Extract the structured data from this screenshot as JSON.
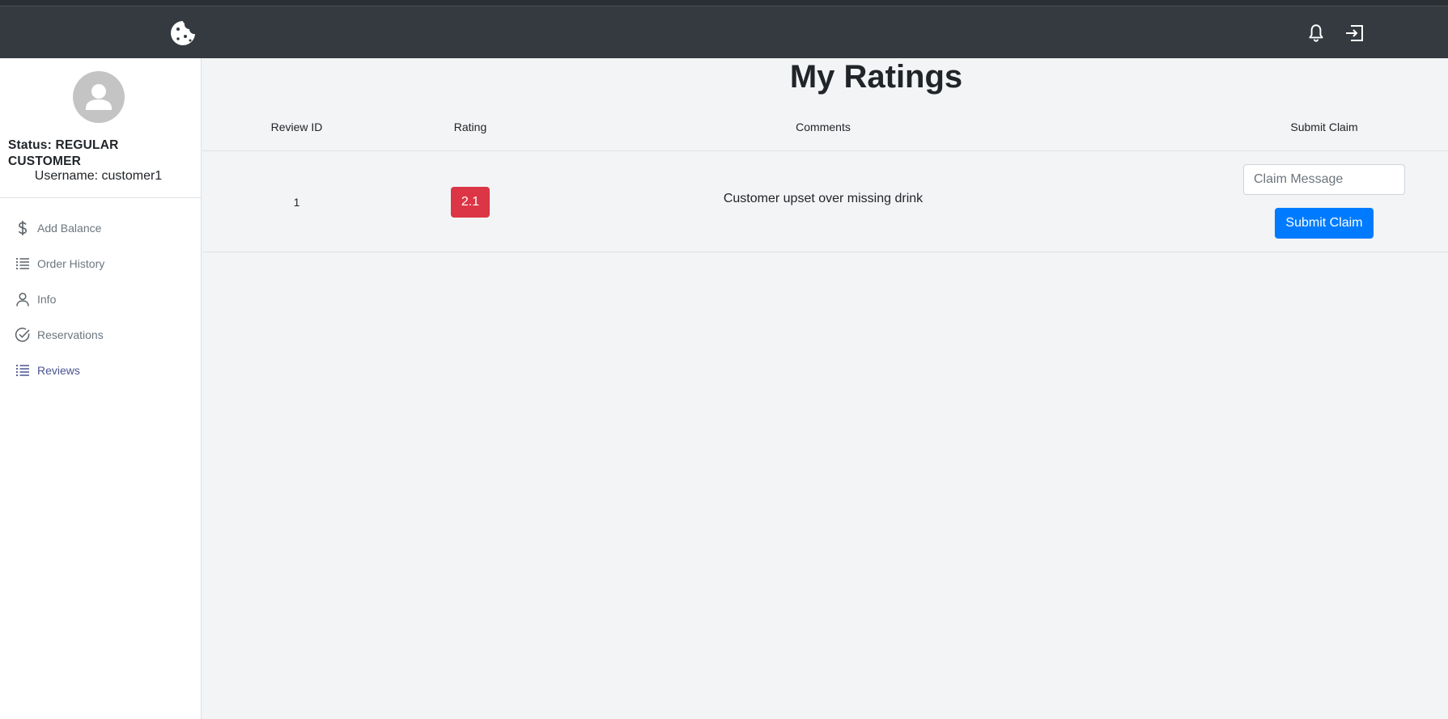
{
  "navbar": {
    "logo_icon": "cookie-icon",
    "bell_icon": "bell-icon",
    "logout_icon": "logout-icon"
  },
  "sidebar": {
    "status": "Status: REGULAR CUSTOMER",
    "username": "Username: customer1",
    "items": [
      {
        "label": "Add Balance",
        "icon": "dollar-icon"
      },
      {
        "label": "Order History",
        "icon": "list-icon"
      },
      {
        "label": "Info",
        "icon": "person-icon"
      },
      {
        "label": "Reservations",
        "icon": "check-circle-icon"
      },
      {
        "label": "Reviews",
        "icon": "list-icon",
        "active": true
      }
    ]
  },
  "main": {
    "title": "My Ratings",
    "columns": [
      "Review ID",
      "Rating",
      "Comments",
      "Submit Claim"
    ],
    "rows": [
      {
        "review_id": "1",
        "rating": "2.1",
        "comment": "Customer upset over missing drink",
        "claim_placeholder": "Claim Message",
        "submit_label": "Submit Claim"
      }
    ]
  },
  "colors": {
    "navbar": "#343a40",
    "badge_danger": "#dc3545",
    "primary": "#007bff"
  }
}
